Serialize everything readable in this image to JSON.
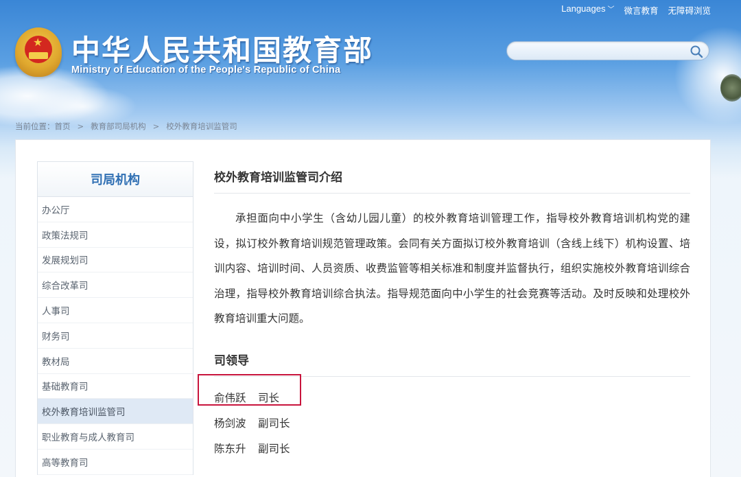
{
  "header": {
    "title_cn": "中华人民共和国教育部",
    "title_en": "Ministry of Education of the People's Republic of China",
    "emblem_icon": "national-emblem-icon",
    "topnav": {
      "languages": "Languages",
      "weiyan": "微言教育",
      "accessible": "无障碍浏览"
    },
    "search": {
      "placeholder": "",
      "icon": "search-icon"
    }
  },
  "breadcrumb": {
    "prefix": "当前位置：",
    "items": [
      "首页",
      "教育部司局机构",
      "校外教育培训监管司"
    ],
    "separator": ">"
  },
  "sidebar": {
    "title": "司局机构",
    "items": [
      {
        "label": "办公厅"
      },
      {
        "label": "政策法规司"
      },
      {
        "label": "发展规划司"
      },
      {
        "label": "综合改革司"
      },
      {
        "label": "人事司"
      },
      {
        "label": "财务司"
      },
      {
        "label": "教材局"
      },
      {
        "label": "基础教育司"
      },
      {
        "label": "校外教育培训监管司",
        "active": true
      },
      {
        "label": "职业教育与成人教育司"
      },
      {
        "label": "高等教育司"
      }
    ]
  },
  "content": {
    "intro_title": "校外教育培训监管司介绍",
    "intro_text": "承担面向中小学生（含幼儿园儿童）的校外教育培训管理工作，指导校外教育培训机构党的建设，拟订校外教育培训规范管理政策。会同有关方面拟订校外教育培训（含线上线下）机构设置、培训内容、培训时间、人员资质、收费监管等相关标准和制度并监督执行，组织实施校外教育培训综合治理，指导校外教育培训综合执法。指导规范面向中小学生的社会竞赛等活动。及时反映和处理校外教育培训重大问题。",
    "leaders_title": "司领导",
    "leaders": [
      {
        "name": "俞伟跃",
        "position": "司长"
      },
      {
        "name": "杨剑波",
        "position": "副司长"
      },
      {
        "name": "陈东升",
        "position": "副司长"
      }
    ]
  },
  "colors": {
    "header_blue": "#3a86d6",
    "sidebar_title": "#2f6fb3",
    "active_item_bg": "#dfe9f5",
    "highlight_red": "#c8143c"
  }
}
